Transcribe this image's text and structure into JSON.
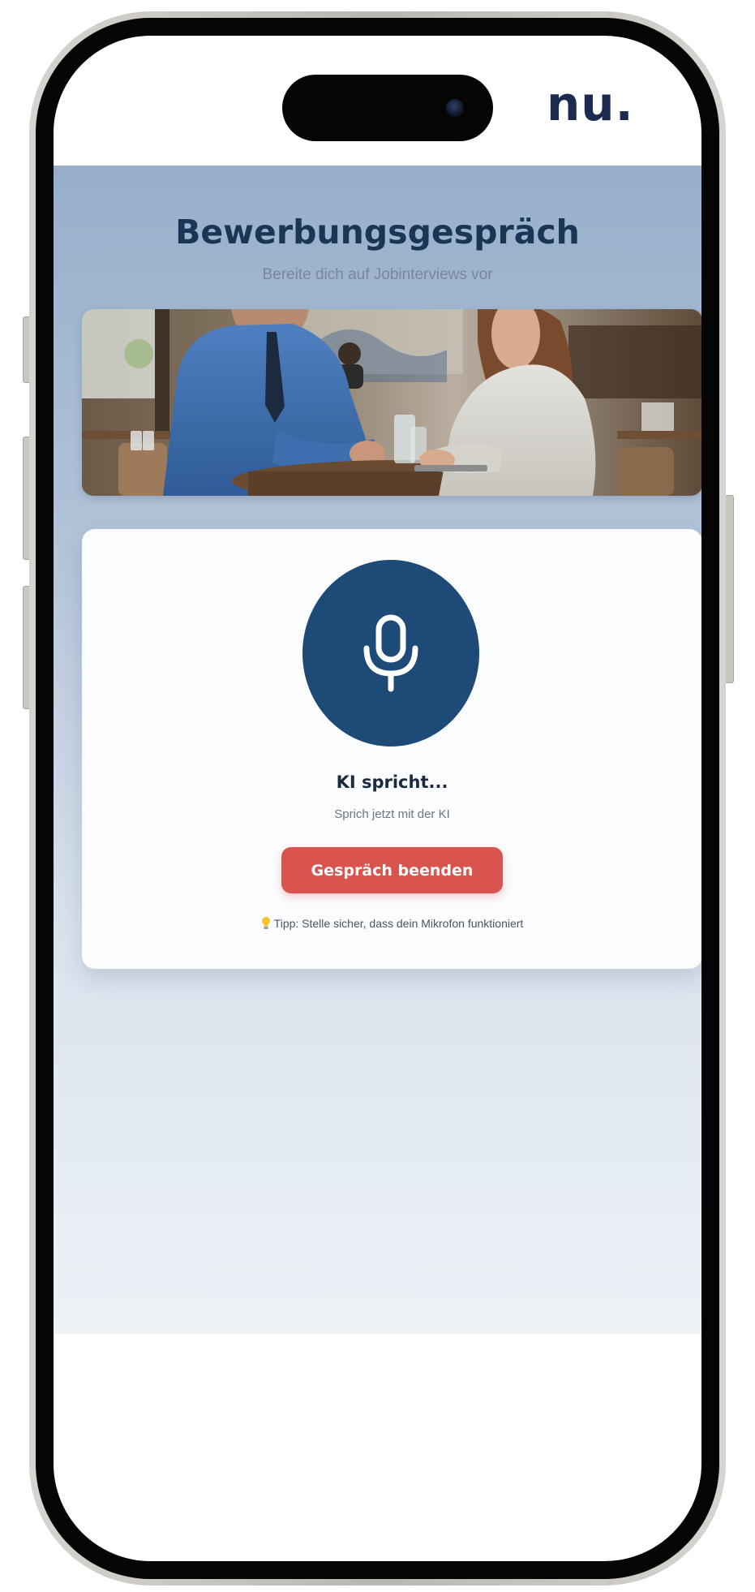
{
  "brand": {
    "logo_text": "nu."
  },
  "app": {
    "title": "Bewerbungsgespräch",
    "subtitle": "Bereite dich auf Jobinterviews vor"
  },
  "hero_image": {
    "icon": "interview-photo"
  },
  "call": {
    "mic_icon": "microphone-icon",
    "status": "KI spricht...",
    "hint": "Sprich jetzt mit der KI",
    "end_button": "Gespräch beenden",
    "tip_icon": "lightbulb-icon",
    "tip": "Tipp: Stelle sicher, dass dein Mikrofon funktioniert"
  },
  "colors": {
    "accent": "#1e4a78",
    "danger": "#d9534f",
    "heading": "#1b3556",
    "brand": "#1b2a4e"
  }
}
